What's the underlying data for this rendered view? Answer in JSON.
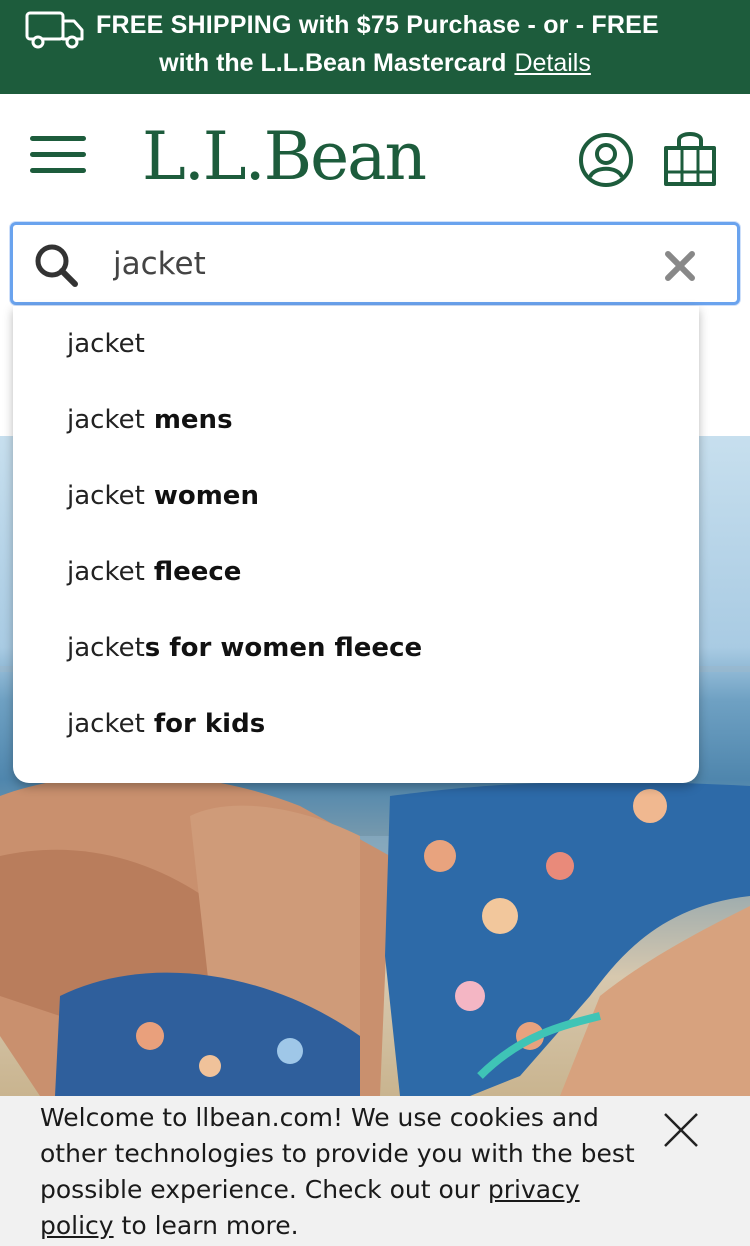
{
  "promo": {
    "line1": "FREE SHIPPING with $75 Purchase - or - FREE",
    "line2": "with the L.L.Bean Mastercard",
    "details_link": "Details",
    "icon": "truck-icon"
  },
  "header": {
    "logo": "L.L.Bean",
    "menu_icon": "hamburger-menu-icon",
    "account_icon": "account-icon",
    "bag_icon": "shopping-bag-icon"
  },
  "search": {
    "value": "jacket",
    "icon": "search-icon",
    "clear_icon": "close-icon"
  },
  "suggestions": [
    {
      "prefix": "jacket",
      "suffix": ""
    },
    {
      "prefix": "jacket",
      "suffix": " mens"
    },
    {
      "prefix": "jacket",
      "suffix": " women"
    },
    {
      "prefix": "jacket",
      "suffix": " fleece"
    },
    {
      "prefix": "jacket",
      "suffix": "s for women fleece"
    },
    {
      "prefix": "jacket",
      "suffix": " for kids"
    }
  ],
  "cookie": {
    "text_before": "Welcome to llbean.com! We use cookies and other technologies to provide you with the best possible experience. Check out our ",
    "link": "privacy policy",
    "text_after": " to learn more."
  },
  "colors": {
    "brand_green": "#1d5c3c",
    "focus_blue": "#6aa3ee"
  }
}
